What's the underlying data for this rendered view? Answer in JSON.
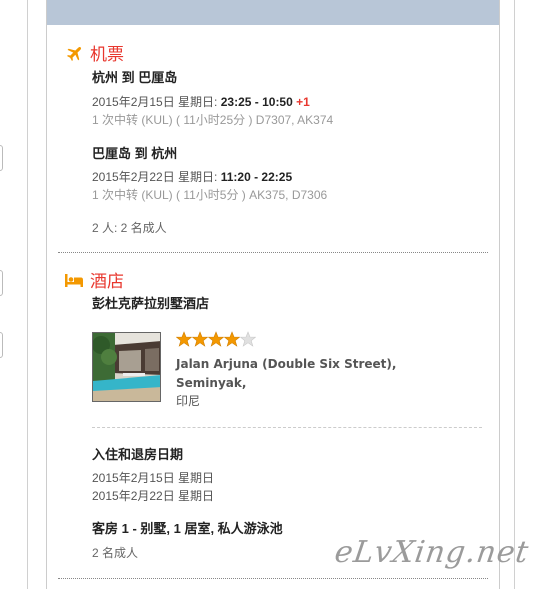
{
  "flight": {
    "section_title": "机票",
    "outbound": {
      "route": "杭州 到 巴厘岛",
      "date_prefix": "2015年2月15日 星期日: ",
      "time": "23:25 - 10:50",
      "day_offset": "+1",
      "details": "1 次中转 (KUL) ( 11小时25分 ) D7307, AK374"
    },
    "return": {
      "route": "巴厘岛 到 杭州",
      "date_prefix": "2015年2月22日 星期日: ",
      "time": "11:20 - 22:25",
      "details": "1 次中转 (KUL) ( 11小时5分 ) AK375, D7306"
    },
    "passengers": "2 人:  2 名成人"
  },
  "hotel": {
    "section_title": "酒店",
    "name": "彭杜克萨拉别墅酒店",
    "rating": 4,
    "rating_max": 5,
    "address_line1": "Jalan Arjuna (Double Six Street),",
    "address_line2": "Seminyak,",
    "country": "印尼",
    "dates_heading": "入住和退房日期",
    "checkin": "2015年2月15日 星期日",
    "checkout": "2015年2月22日 星期日",
    "room": "客房 1 - 别墅, 1 居室, 私人游泳池",
    "guests": "2 名成人"
  },
  "watermark": "eLvXing.net",
  "colors": {
    "accent_red": "#e8372e",
    "icon_orange": "#f39800",
    "header_bar": "#b8c6d7",
    "star_filled": "#f39800",
    "star_empty": "#e0e0e0"
  },
  "icons": {
    "flight": "airplane-icon",
    "hotel": "bed-icon"
  }
}
